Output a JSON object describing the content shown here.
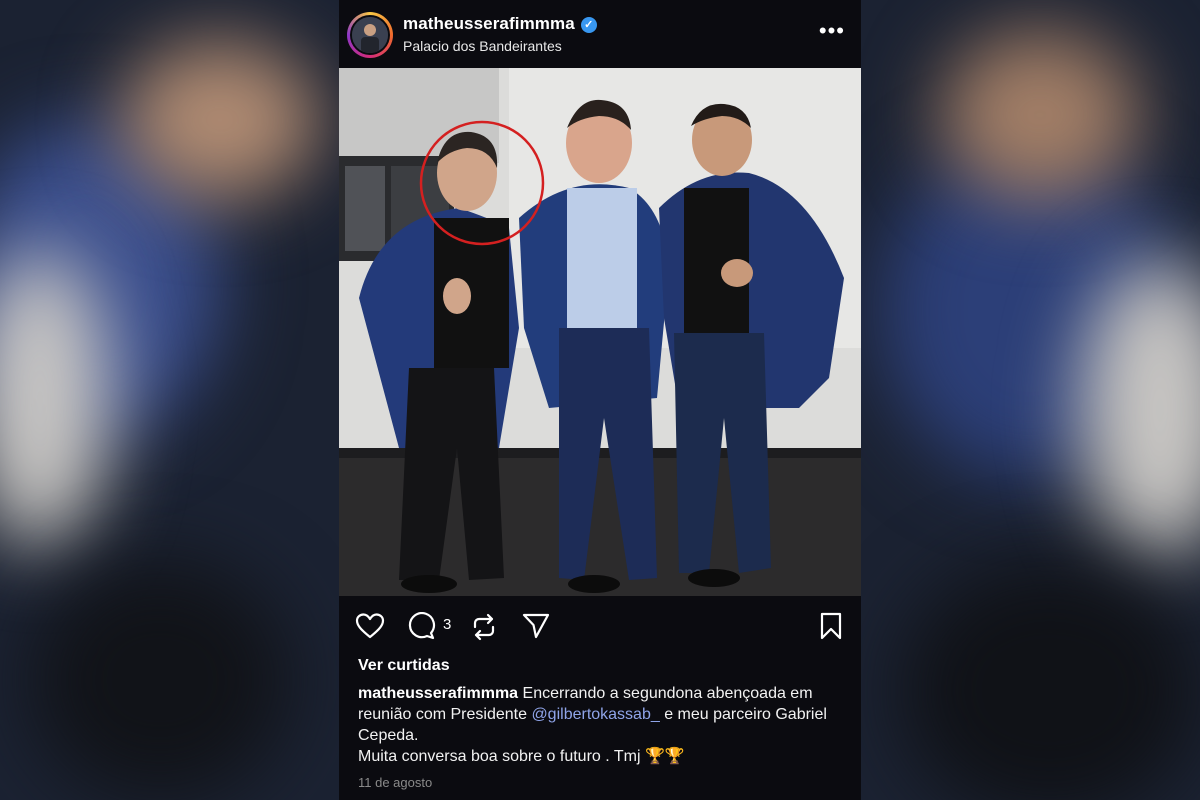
{
  "post": {
    "username": "matheusserafimmma",
    "location": "Palacio dos Bandeirantes",
    "comment_count": "3",
    "likes_label": "Ver curtidas",
    "caption": {
      "user": "matheusserafimmma",
      "text_1": "Encerrando a segundona abençoada em reunião com Presidente",
      "mention": "@gilbertokassab_",
      "text_2": " e meu parceiro Gabriel Cepeda.",
      "line_2": "Muita conversa boa sobre o futuro . Tmj 🏆🏆"
    },
    "date": "11 de agosto"
  },
  "icons": [
    "verified-icon",
    "more-options-icon",
    "heart-icon",
    "comment-icon",
    "repost-icon",
    "share-icon",
    "bookmark-icon"
  ],
  "colors": {
    "background": "#0b0b10",
    "mention": "#8fa4e8",
    "verified": "#3897f0",
    "annotation_circle": "#d42020"
  }
}
